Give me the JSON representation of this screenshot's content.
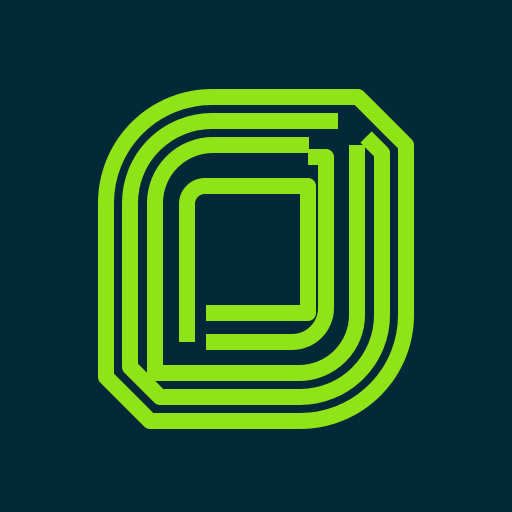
{
  "app": {
    "icon_name": "app-logo-icon",
    "background_color": "#032838",
    "accent_color": "#8EE416"
  }
}
